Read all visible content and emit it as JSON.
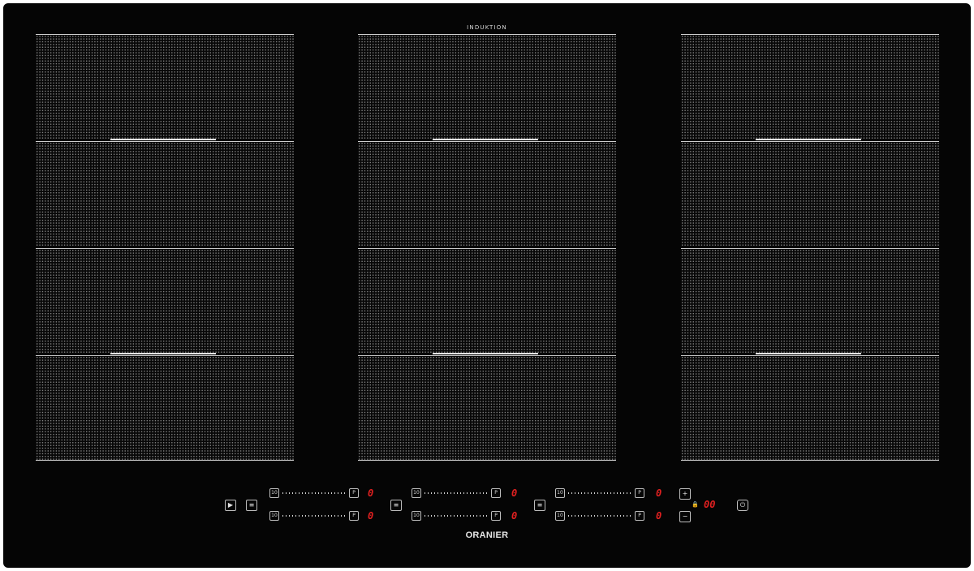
{
  "cooktop": {
    "top_label": "INDUKTION",
    "brand": "ORANIER",
    "colors": {
      "glass": "#050505",
      "zone_dots": "#8a8a8a",
      "display": "#e02020",
      "marking": "#cfcfcf"
    },
    "columns": [
      {
        "zones": 4
      },
      {
        "zones": 4
      },
      {
        "zones": 4
      }
    ]
  },
  "controls": {
    "start_icon": "play-icon",
    "bridge_icon": "bridge-icon",
    "slider_min_label": "10",
    "slider_max_label": "P",
    "level_display": "0",
    "plus_label": "+",
    "minus_label": "−",
    "timer_display": "00",
    "power_icon": "power-icon",
    "lock_icon": "lock-icon"
  }
}
